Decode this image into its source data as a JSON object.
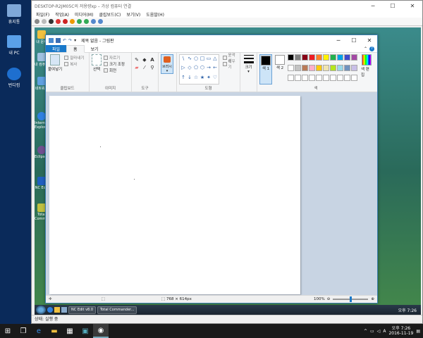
{
  "desktop_icons": [
    {
      "label": "휴지통",
      "color": "#7fa8d8"
    },
    {
      "label": "내 PC",
      "color": "#5aa0e8"
    },
    {
      "label": "번디컴",
      "color": "#1e6fcf"
    }
  ],
  "vm": {
    "title": "DESKTOP-R2JM05C의 저용량xp – 가상 컴퓨터 연결",
    "menu": [
      "파일(F)",
      "작업(A)",
      "미디어(M)",
      "클립보드(C)",
      "보기(V)",
      "도움말(H)"
    ],
    "status": "상태: 실행 중"
  },
  "guest_icons": [
    {
      "label": "내 문서",
      "color": "#f0c040"
    },
    {
      "label": "내 컴퓨터",
      "color": "#a0c0e0"
    },
    {
      "label": "네트워크",
      "color": "#60a0e0"
    },
    {
      "label": "Internet Explorer",
      "color": "#3080e0"
    },
    {
      "label": "EclipsePortable",
      "color": "#705090"
    },
    {
      "label": "NC Edit",
      "color": "#2060c0"
    },
    {
      "label": "Total Commander",
      "color": "#c0c040"
    }
  ],
  "guest_taskbar": {
    "items": [
      "NC Edit v8.0",
      "Total Commander..."
    ],
    "clock": "오후 7:26"
  },
  "paint": {
    "title": "제목 없음 - 그림판",
    "tabs": {
      "file": "파일",
      "home": "홈",
      "view": "보기"
    },
    "clipboard": {
      "paste": "붙여넣기",
      "cut": "잘라내기",
      "copy": "복사",
      "label": "클립보드"
    },
    "image": {
      "select": "선택",
      "crop": "자르기",
      "resize": "크기 조정",
      "rotate": "회전",
      "label": "이미지"
    },
    "tools": {
      "label": "도구"
    },
    "brushes": {
      "label": "브러시"
    },
    "shapes": {
      "outline": "윤곽선",
      "fill": "채우기",
      "label": "도형",
      "glyphs": [
        "\\",
        "∿",
        "○",
        "□",
        "▭",
        "△",
        "▷",
        "◇",
        "⬠",
        "⬡",
        "→",
        "←",
        "↑",
        "↓",
        "☆",
        "★",
        "✦",
        "♡"
      ]
    },
    "size": {
      "label": "크기"
    },
    "color1": {
      "label": "색 1",
      "value": "#000000"
    },
    "color2": {
      "label": "색 2",
      "value": "#ffffff"
    },
    "colors_label": "색",
    "edit_colors": "색 편집",
    "palette": [
      "#000000",
      "#7f7f7f",
      "#880015",
      "#ed1c24",
      "#ff7f27",
      "#fff200",
      "#22b14c",
      "#00a2e8",
      "#3f48cc",
      "#a349a4",
      "#ffffff",
      "#c3c3c3",
      "#b97a57",
      "#ffaec9",
      "#ffc90e",
      "#efe4b0",
      "#b5e61d",
      "#99d9ea",
      "#7092be",
      "#c8bfe7",
      "#ffffff",
      "#ffffff",
      "#ffffff",
      "#ffffff",
      "#ffffff",
      "#ffffff",
      "#ffffff",
      "#ffffff",
      "#ffffff",
      "#ffffff"
    ],
    "status": {
      "dimensions": "768 × 614px",
      "zoom": "100%",
      "zoom_fraction": 0.5
    }
  },
  "host_tray": {
    "language": "A",
    "time": "오후 7:26",
    "date": "2016-11-19"
  }
}
